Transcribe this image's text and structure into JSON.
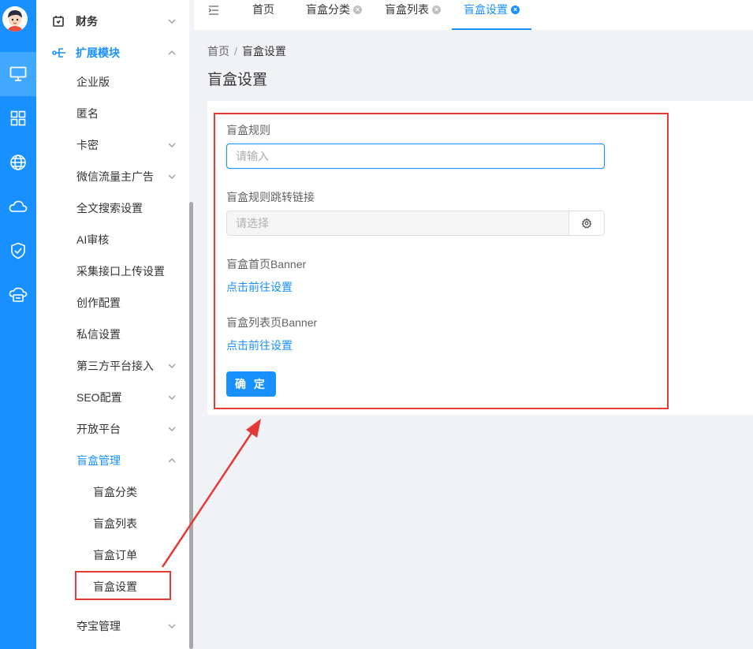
{
  "sidebar": {
    "items": [
      {
        "label": "财务",
        "level": "top",
        "icon": "wallet-icon",
        "chevron": "down"
      },
      {
        "label": "扩展模块",
        "level": "top",
        "icon": "extension-icon",
        "chevron": "up",
        "active": true
      },
      {
        "label": "企业版",
        "level": "sub"
      },
      {
        "label": "匿名",
        "level": "sub"
      },
      {
        "label": "卡密",
        "level": "sub",
        "chevron": "down"
      },
      {
        "label": "微信流量主广告",
        "level": "sub",
        "chevron": "down"
      },
      {
        "label": "全文搜索设置",
        "level": "sub"
      },
      {
        "label": "AI审核",
        "level": "sub"
      },
      {
        "label": "采集接口上传设置",
        "level": "sub"
      },
      {
        "label": "创作配置",
        "level": "sub"
      },
      {
        "label": "私信设置",
        "level": "sub"
      },
      {
        "label": "第三方平台接入",
        "level": "sub",
        "chevron": "down"
      },
      {
        "label": "SEO配置",
        "level": "sub",
        "chevron": "down"
      },
      {
        "label": "开放平台",
        "level": "sub",
        "chevron": "down"
      },
      {
        "label": "盲盒管理",
        "level": "sub",
        "chevron": "up",
        "active": true
      },
      {
        "label": "盲盒分类",
        "level": "subsub"
      },
      {
        "label": "盲盒列表",
        "level": "subsub"
      },
      {
        "label": "盲盒订单",
        "level": "subsub"
      },
      {
        "label": "盲盒设置",
        "level": "subsub",
        "selected": true
      },
      {
        "label": "夺宝管理",
        "level": "sub",
        "chevron": "down"
      }
    ]
  },
  "rail": {
    "icons": [
      "monitor-icon",
      "grid-icon",
      "globe-icon",
      "cloud-icon",
      "shield-check-icon",
      "cloud-storage-icon"
    ]
  },
  "tabs": {
    "items": [
      {
        "label": "首页",
        "closable": false
      },
      {
        "label": "盲盒分类",
        "closable": true
      },
      {
        "label": "盲盒列表",
        "closable": true
      },
      {
        "label": "盲盒设置",
        "closable": true,
        "active": true
      }
    ]
  },
  "breadcrumb": {
    "home": "首页",
    "separator": "/",
    "current": "盲盒设置"
  },
  "page": {
    "title": "盲盒设置"
  },
  "form": {
    "rule_label": "盲盒规则",
    "rule_placeholder": "请输入",
    "rule_link_label": "盲盒规则跳转链接",
    "rule_link_placeholder": "请选择",
    "home_banner_label": "盲盒首页Banner",
    "home_banner_link": "点击前往设置",
    "list_banner_label": "盲盒列表页Banner",
    "list_banner_link": "点击前往设置",
    "submit_label": "确 定"
  },
  "colors": {
    "primary": "#1890ff",
    "rail": "#1890ff",
    "annotation": "#e53935",
    "background": "#f0f2f5"
  }
}
